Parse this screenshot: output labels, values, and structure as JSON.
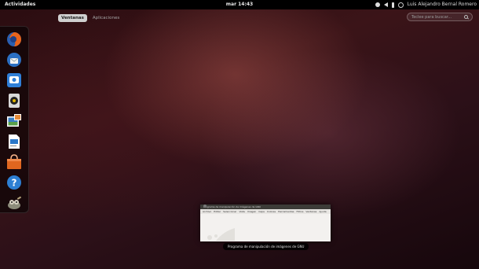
{
  "topbar": {
    "activities_label": "Actividades",
    "clock": "mar 14:43",
    "user_name": "Luis Alejandro Bernal Romero"
  },
  "tabs": [
    {
      "label": "Ventanas",
      "active": true
    },
    {
      "label": "Aplicaciones",
      "active": false
    }
  ],
  "search": {
    "placeholder": "Teclee para buscar..."
  },
  "dash": {
    "items": [
      {
        "icon": "firefox-icon"
      },
      {
        "icon": "thunderbird-icon"
      },
      {
        "icon": "empathy-icon"
      },
      {
        "icon": "rhythmbox-icon"
      },
      {
        "icon": "shotwell-icon"
      },
      {
        "icon": "libreoffice-writer-icon"
      },
      {
        "icon": "software-center-icon"
      },
      {
        "icon": "help-icon"
      },
      {
        "icon": "gimp-icon"
      }
    ]
  },
  "window": {
    "title": "Programa de manipulación de imágenes de GNU",
    "menu": [
      "Archivo",
      "Editar",
      "Seleccionar",
      "Vista",
      "Imagen",
      "Capa",
      "Colores",
      "Herramientas",
      "Filtros",
      "Ventanas",
      "Ayuda"
    ],
    "caption": "Programa de manipulación de imágenes de GNU"
  },
  "colors": {
    "accent_tab": "#d0d0d0",
    "panel": "#000000"
  }
}
